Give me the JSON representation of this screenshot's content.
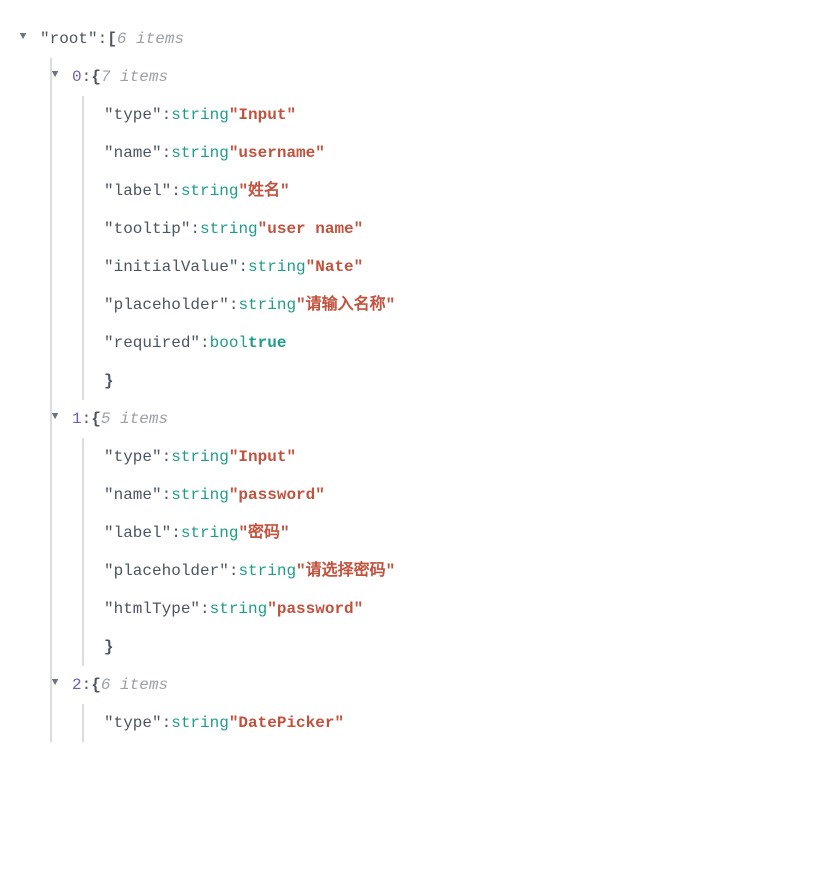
{
  "root": {
    "key": "root",
    "bracket": "[",
    "meta": "6 items",
    "items": [
      {
        "idx": "0",
        "brace": "{",
        "meta": "7 items",
        "props": [
          {
            "key": "type",
            "typeTok": "string",
            "typeClass": "type-s",
            "val": "Input",
            "valClass": "val-s",
            "quoted": true
          },
          {
            "key": "name",
            "typeTok": "string",
            "typeClass": "type-s",
            "val": "username",
            "valClass": "val-s",
            "quoted": true
          },
          {
            "key": "label",
            "typeTok": "string",
            "typeClass": "type-s",
            "val": "姓名",
            "valClass": "val-s",
            "quoted": true
          },
          {
            "key": "tooltip",
            "typeTok": "string",
            "typeClass": "type-s",
            "val": "user name",
            "valClass": "val-s",
            "quoted": true
          },
          {
            "key": "initialValue",
            "typeTok": "string",
            "typeClass": "type-s",
            "val": "Nate",
            "valClass": "val-s",
            "quoted": true
          },
          {
            "key": "placeholder",
            "typeTok": "string",
            "typeClass": "type-s",
            "val": "请输入名称",
            "valClass": "val-s",
            "quoted": true
          },
          {
            "key": "required",
            "typeTok": "bool",
            "typeClass": "type-b",
            "val": "true",
            "valClass": "val-b",
            "quoted": false
          }
        ],
        "close": "}"
      },
      {
        "idx": "1",
        "brace": "{",
        "meta": "5 items",
        "props": [
          {
            "key": "type",
            "typeTok": "string",
            "typeClass": "type-s",
            "val": "Input",
            "valClass": "val-s",
            "quoted": true
          },
          {
            "key": "name",
            "typeTok": "string",
            "typeClass": "type-s",
            "val": "password",
            "valClass": "val-s",
            "quoted": true
          },
          {
            "key": "label",
            "typeTok": "string",
            "typeClass": "type-s",
            "val": "密码",
            "valClass": "val-s",
            "quoted": true
          },
          {
            "key": "placeholder",
            "typeTok": "string",
            "typeClass": "type-s",
            "val": "请选择密码",
            "valClass": "val-s",
            "quoted": true
          },
          {
            "key": "htmlType",
            "typeTok": "string",
            "typeClass": "type-s",
            "val": "password",
            "valClass": "val-s",
            "quoted": true
          }
        ],
        "close": "}"
      },
      {
        "idx": "2",
        "brace": "{",
        "meta": "6 items",
        "props": [
          {
            "key": "type",
            "typeTok": "string",
            "typeClass": "type-s",
            "val": "DatePicker",
            "valClass": "val-s",
            "quoted": true
          }
        ],
        "close": null
      }
    ]
  }
}
